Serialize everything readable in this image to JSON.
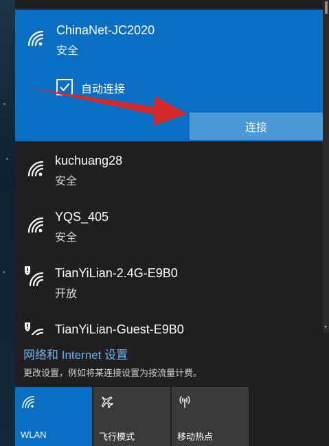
{
  "selected_network": {
    "name": "ChinaNet-JC2020",
    "status": "安全",
    "auto_connect_label": "自动连接",
    "auto_connect_checked": true,
    "connect_button": "连接",
    "icon": "wifi-signal-icon"
  },
  "networks": [
    {
      "name": "kuchuang28",
      "status": "安全",
      "icon": "wifi-signal-icon"
    },
    {
      "name": "YQS_405",
      "status": "安全",
      "icon": "wifi-signal-icon"
    },
    {
      "name": "TianYiLian-2.4G-E9B0",
      "status": "开放",
      "icon": "wifi-open-shield-icon"
    },
    {
      "name": "TianYiLian-Guest-E9B0",
      "status": "",
      "icon": "wifi-open-shield-icon"
    }
  ],
  "settings": {
    "link": "网络和 Internet 设置",
    "description": "更改设置，例如将某连接设置为按流量计费。"
  },
  "quick_actions": [
    {
      "label": "WLAN",
      "icon": "wifi-icon",
      "active": true
    },
    {
      "label": "飞行模式",
      "icon": "airplane-icon",
      "active": false
    },
    {
      "label": "移动热点",
      "icon": "hotspot-icon",
      "active": false
    }
  ],
  "colors": {
    "accent": "#0a6fc2",
    "panel_bg": "#1f1f1f",
    "tile_bg": "#3a3a3a",
    "link": "#6fb3f0",
    "annotation_arrow": "#d62a2a"
  }
}
